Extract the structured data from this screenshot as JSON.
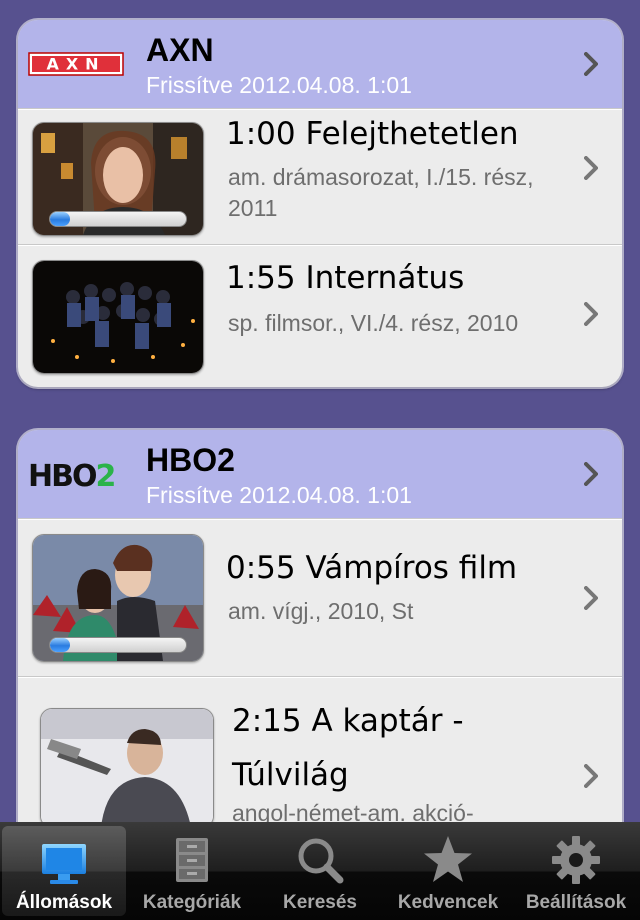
{
  "stations": [
    {
      "name": "AXN",
      "logo_text": "AXN",
      "updated": "Frissítve 2012.04.08. 1:01",
      "programs": [
        {
          "title": "1:00 Felejthetetlen",
          "desc": "am. drámasorozat, I./15. rész, 2011",
          "progress": 0.15
        },
        {
          "title": "1:55 Internátus",
          "desc": "sp. filmsor., VI./4. rész, 2010"
        }
      ]
    },
    {
      "name": "HBO2",
      "logo_text": "HBO2",
      "updated": "Frissítve 2012.04.08. 1:01",
      "programs": [
        {
          "title": "0:55 Vámpíros film",
          "desc": "am. vígj., 2010, St",
          "progress": 0.15
        },
        {
          "title": "2:15 A kaptár - Túlvilág",
          "desc": "angol-német-am. akció-"
        }
      ]
    }
  ],
  "tabs": [
    {
      "label": "Állomások",
      "icon": "monitor-icon",
      "active": true
    },
    {
      "label": "Kategóriák",
      "icon": "cabinet-icon"
    },
    {
      "label": "Keresés",
      "icon": "search-icon"
    },
    {
      "label": "Kedvencek",
      "icon": "star-icon"
    },
    {
      "label": "Beállítások",
      "icon": "gear-icon"
    }
  ],
  "colors": {
    "background": "#57518f",
    "header": "#b3b4ea",
    "card": "#ececec",
    "axn_red": "#e0303a",
    "hbo_green": "#2bb34a"
  }
}
